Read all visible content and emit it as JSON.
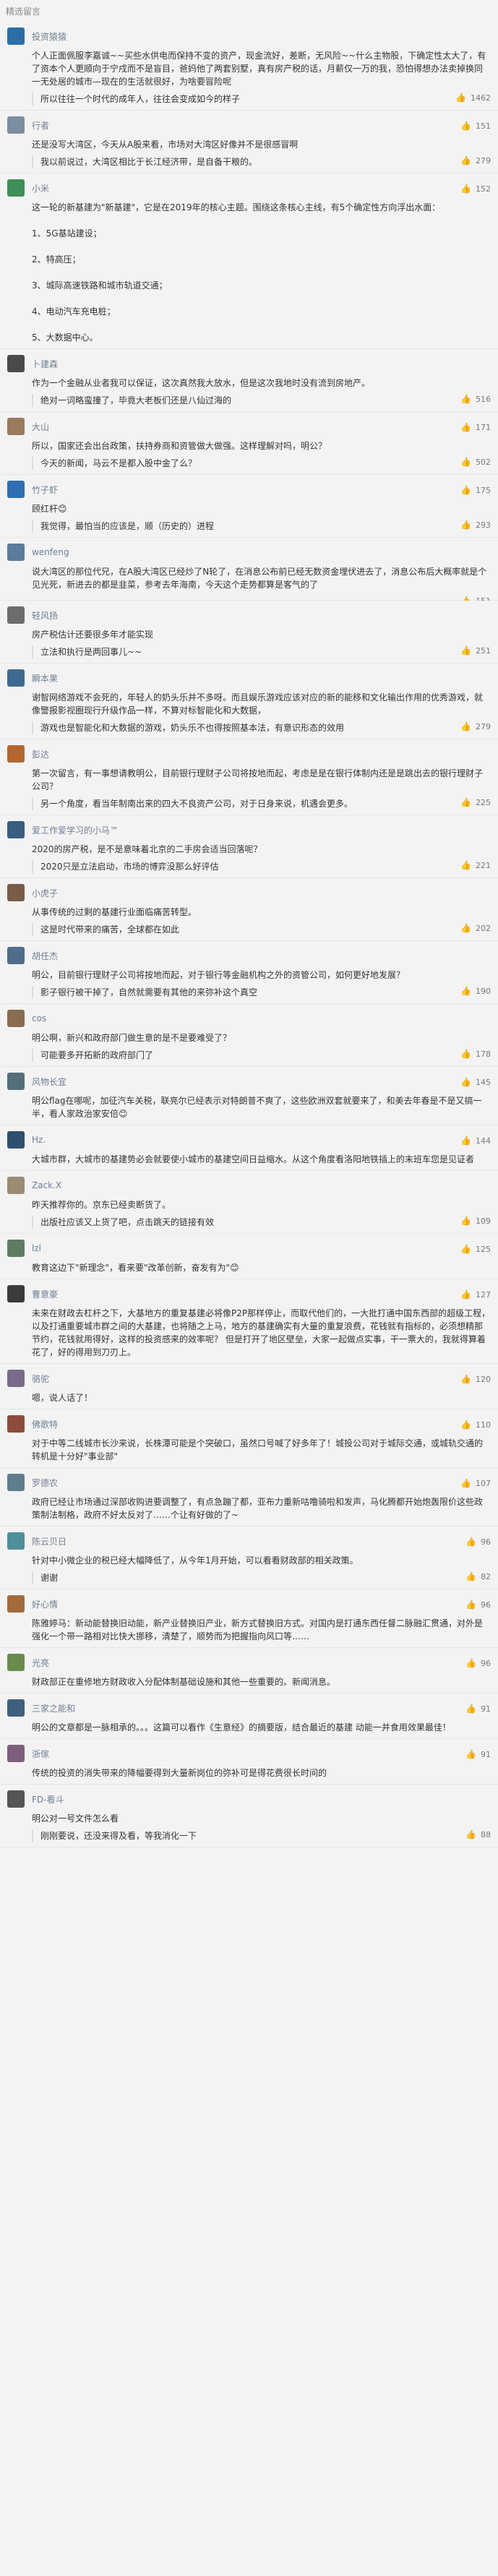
{
  "header": {
    "title": "精选留言"
  },
  "comments": [
    {
      "name": "投资猿猿",
      "text": "个人正面佩服李嘉诚~~买些水供电而保持不变的资产，现金流好，差断，无风险~~什么主物股，下确定性太大了，有了资本个人更顺向于宁戍而不是盲目，爸妈他了两套别墅，真有房产税的话，月薪仅一万的我，恐怕得想办法卖掉换同一无处居的城市—现在的生活就很好，为啥要冒险呢",
      "likes": "",
      "reply": {
        "text": "所以往往一个时代的成年人，往往会变成如今的样子",
        "likes": "1462"
      }
    },
    {
      "name": "行者",
      "text": "还是没写大湾区，今天从A股来看，市场对大湾区好像并不是很感冒啊",
      "likes": "151",
      "reply": {
        "text": "我以前说过，大湾区相比于长江经济带，是自备干粮的。",
        "likes": "279"
      }
    },
    {
      "name": "小米",
      "text": "这一轮的新基建为\"新基建\"，它是在2019年的核心主题。围绕这条核心主线，有5个确定性方向浮出水面：\n\n1、5G基站建设；\n\n2、特高压；\n\n3、城际高速铁路和城市轨道交通；\n\n4、电动汽车充电桩；\n\n5、大数据中心。",
      "likes": "152",
      "reply": null
    },
    {
      "name": "卜建森",
      "text": "作为一个金融从业者我可以保证，这次真然我大放水，但是这次我地时没有流到房地产。",
      "likes": "",
      "reply": {
        "text": "绝对一词略蛮撞了，毕竟大老板们还是八仙过海的",
        "likes": "516"
      }
    },
    {
      "name": "大山",
      "text": "所以，国家还会出台政策，扶持券商和资管做大做强。这样理解对吗，明公？",
      "likes": "171",
      "reply": {
        "text": "今天的新闻，马云不是都入股中金了么？",
        "likes": "502"
      }
    },
    {
      "name": "竹子虾",
      "text": "顾红杆😊",
      "likes": "175",
      "reply": {
        "text": "我觉得，最怕当的应该是，顺（历史的）进程",
        "likes": "293"
      }
    },
    {
      "name": "wenfeng",
      "text": "说大湾区的那位代兄，在A股大湾区已经炒了N轮了，在消息公布前已经无数资金埋伏进去了，消息公布后大概率就是个见光死，新进去的都是韭菜，参考去年海南，今天这个走势都算是客气的了",
      "likes": "",
      "reply": {
        "text": "",
        "likes": "151"
      }
    },
    {
      "name": "轻风扬",
      "text": "房产税估计还要很多年才能实现",
      "likes": "",
      "reply": {
        "text": "立法和执行是两回事儿~~",
        "likes": "251"
      }
    },
    {
      "name": "瞬本果",
      "text": "谢智网络游戏不会死的，年轻人的奶头乐并不多呀。而且娱乐游戏应该对应的新的能移和文化输出作用的优秀游戏，就像警报影视圈现行升级作品一样，不算对标智能化和大数据，",
      "likes": "",
      "reply": {
        "text": "游戏也是智能化和大数据的游戏，奶头乐不也得按照基本法，有意识形态的效用",
        "likes": "279"
      }
    },
    {
      "name": "彭达",
      "text": "第一次留言，有一事想请教明公，目前银行理财子公司将按地而起，考虑是是在银行体制内还是是跳出去的银行理财子公司？",
      "likes": "",
      "reply": {
        "text": "另一个角度，看当年制南出来的四大不良资产公司，对于日身来说，机遇会更多。",
        "likes": "225"
      }
    },
    {
      "name": "爱工作爱学习的小马™",
      "text": "2020的房产税，是不是意味着北京的二手房会适当回落呢？",
      "likes": "",
      "reply": {
        "text": "2020只是立法启动，市场的博弈没那么好评估",
        "likes": "221"
      }
    },
    {
      "name": "小虎子",
      "text": "从事传统的过剩的基建行业面临痛苦转型。",
      "likes": "",
      "reply": {
        "text": "这是时代带来的痛苦，全球都在如此",
        "likes": "202"
      }
    },
    {
      "name": "胡任杰",
      "text": "明公，目前银行理财子公司将按地而起，对于银行等金融机构之外的资管公司，如何更好地发展？",
      "likes": "",
      "reply": {
        "text": "影子银行被干掉了，自然就需要有其他的来弥补这个真空",
        "likes": "190"
      }
    },
    {
      "name": "cos",
      "text": "明公啊，新兴和政府部门做生意的是不是要难受了？",
      "likes": "",
      "reply": {
        "text": "可能要多开拓新的政府部门了",
        "likes": "178"
      }
    },
    {
      "name": "风物长宜",
      "text": "明公flag在哪呢，加征汽车关税，联亮尔已经表示对特朗普不爽了，这些欧洲双套就要来了，和美去年春是不是又搞一半，看人家政治家安倍😊",
      "likes": "145",
      "reply": null
    },
    {
      "name": "Hz.",
      "text": "大城市群，大城市的基建势必会就要使小城市的基建空间日益缩水。从这个角度看洛阳地铁插上的末班车您是见证者",
      "likes": "144",
      "reply": null
    },
    {
      "name": "Zack.X",
      "text": "昨天推荐你的。京东已经卖断货了。",
      "likes": "",
      "reply": {
        "text": "出版社应该又上货了吧，点击跳天的链接有效",
        "likes": "109"
      }
    },
    {
      "name": "lzl",
      "text": "教育这边下\"新理念\"，看来要\"改革创新，奋发有为\"😊",
      "likes": "125",
      "reply": null
    },
    {
      "name": "曹意豪",
      "text": "未来在财政去杠杆之下，大基地方的重复基建必将像P2P那样停止，而取代他们的，一大批打通中国东西部的超级工程，以及打通重要城市群之间的大基建，也将随之上马，地方的基建确实有大量的重复浪费，花钱就有指标的，必须想精那节约，花钱就用得好，这样的投资感来的效率呢？ 但是打开了地区壁垒，大家一起做点实事，干一票大的，我就得算着花了，好的得用到刀刃上。",
      "likes": "127",
      "reply": null
    },
    {
      "name": "骆驼",
      "text": "嗯，说人话了！",
      "likes": "120",
      "reply": null
    },
    {
      "name": "佛歌特",
      "text": "对于中等二线城市长沙来说，长株潭可能是个突破口，虽然口号喊了好多年了！城投公司对于城际交通，或城轨交通的转机是十分好\"事业部\"",
      "likes": "110",
      "reply": null
    },
    {
      "name": "罗德农",
      "text": "政府已经让市场通过深部收购进要调整了，有点急蹦了都，亚布力重新咕噜骑啦和发声，马化腾都开始炮轰限价这些政策制法制格，政府不好太反对了……个让有好做的了~",
      "likes": "107",
      "reply": null
    },
    {
      "name": "陈云贝日",
      "text": "针对中小微企业的税已经大幅降低了，从今年1月开始，可以看看财政部的相关政策。",
      "likes": "96",
      "reply": {
        "text": "谢谢",
        "likes": "82"
      }
    },
    {
      "name": "好心情",
      "text": "陈雅婷马：新动能替换旧动能，新产业替换旧产业，新方式替换旧方式。对国内是打通东西任督二脉融汇贯通，对外是强化一个带一路相对比快大挪移，清楚了，顺势而为把握指向风口等……",
      "likes": "96",
      "reply": null
    },
    {
      "name": "光亮",
      "text": "财政部正在重修地方财政收入分配体制基础设施和其他一些重要的。新闻消息。",
      "likes": "96",
      "reply": null
    },
    {
      "name": "三家之能和",
      "text": "明公的文章都是一脉相承的。。。这篇可以看作《生意经》的摘要版，结合最近的基建 动能一并食用效果最佳！",
      "likes": "91",
      "reply": null
    },
    {
      "name": "浙傢",
      "text": "传统的投资的消失带来的降幅要得到大量新岗位的弥补可是得花费很长时间的",
      "likes": "91",
      "reply": null
    },
    {
      "name": "FD-看斗",
      "text": "明公对一号文件怎么看",
      "likes": "",
      "reply": {
        "text": "刚刚要说，还没来得及看，等我消化一下",
        "likes": "88"
      }
    }
  ],
  "colors": {
    "avatars": [
      "#2b6ea6",
      "#7d8ea0",
      "#3e8f5a",
      "#4a4a4a",
      "#9a7b5d",
      "#2f6eb0",
      "#5b7a9c",
      "#6d6d6d",
      "#3d6b8f",
      "#b3662e",
      "#395d80",
      "#7a5b48",
      "#4f6d8b",
      "#8a6c52",
      "#546e7a",
      "#2f4f6f",
      "#9a8b72",
      "#5f7c62",
      "#3b3b3b",
      "#7b6b8a",
      "#8d4c3b",
      "#607d8b",
      "#4e8f9a",
      "#a36a3c",
      "#6a8b4b",
      "#3f5f7f",
      "#7d5f7d",
      "#555555"
    ]
  }
}
